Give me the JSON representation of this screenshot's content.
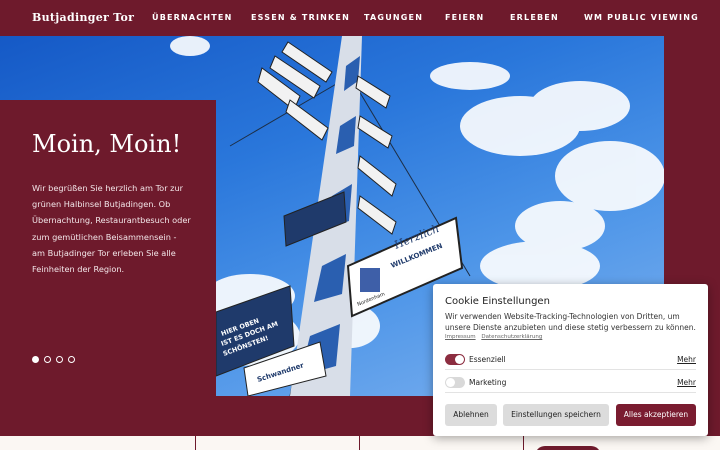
{
  "header": {
    "brand": "Butjadinger Tor",
    "nav": [
      "ÜBERNACHTEN",
      "ESSEN & TRINKEN",
      "TAGUNGEN",
      "FEIERN",
      "ERLEBEN",
      "WM PUBLIC VIEWING"
    ]
  },
  "hero": {
    "title": "Moin, Moin!",
    "text": "Wir begrüßen Sie herzlich am Tor zur grünen Halbinsel Butjadingen. Ob Übernachtung, Restaurantbesuch oder zum gemütlichen Beisammensein - am Butjadinger Tor erleben Sie alle Feinheiten der Region.",
    "slides": 4,
    "active_slide": 1,
    "sign_herzlich": "Herzlich",
    "sign_willkommen": "WILLKOMMEN",
    "sign_nordenham": "Nordenham",
    "sign_hier": [
      "HIER OBEN",
      "IST ES DOCH AM",
      "SCHÖNSTEN!"
    ],
    "sign_schwandner": "Schwandner"
  },
  "cookie": {
    "title": "Cookie Einstellungen",
    "text": "Wir verwenden Website-Tracking-Technologien von Dritten, um unsere Dienste anzubieten und diese stetig verbessern zu können.",
    "links": [
      "Impressum",
      "Datenschutzerklärung"
    ],
    "options": [
      {
        "label": "Essenziell",
        "enabled": true,
        "more": "Mehr"
      },
      {
        "label": "Marketing",
        "enabled": false,
        "more": "Mehr"
      }
    ],
    "buttons": {
      "reject": "Ablehnen",
      "save": "Einstellungen speichern",
      "accept": "Alles akzeptieren"
    }
  },
  "colors": {
    "brand": "#6e1a2c",
    "accent": "#7a1c30",
    "sky": "#2a77db"
  }
}
